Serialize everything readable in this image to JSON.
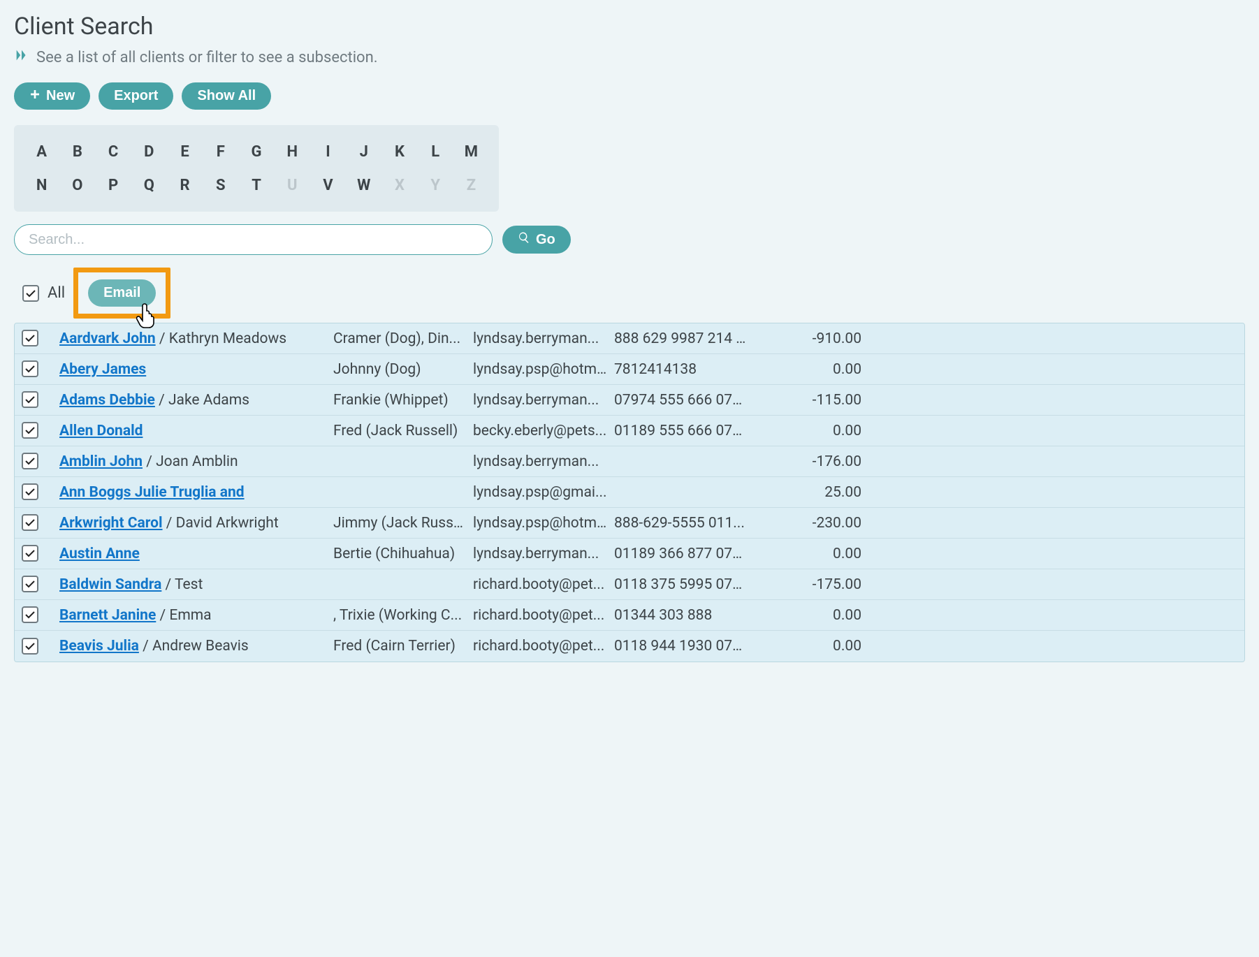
{
  "page": {
    "title": "Client Search",
    "subtitle": "See a list of all clients or filter to see a subsection."
  },
  "actions": {
    "new": "New",
    "export": "Export",
    "show_all": "Show All"
  },
  "alpha": {
    "row1": [
      {
        "l": "A",
        "on": true
      },
      {
        "l": "B",
        "on": true
      },
      {
        "l": "C",
        "on": true
      },
      {
        "l": "D",
        "on": true
      },
      {
        "l": "E",
        "on": true
      },
      {
        "l": "F",
        "on": true
      },
      {
        "l": "G",
        "on": true
      },
      {
        "l": "H",
        "on": true
      },
      {
        "l": "I",
        "on": true
      },
      {
        "l": "J",
        "on": true
      },
      {
        "l": "K",
        "on": true
      },
      {
        "l": "L",
        "on": true
      },
      {
        "l": "M",
        "on": true
      }
    ],
    "row2": [
      {
        "l": "N",
        "on": true
      },
      {
        "l": "O",
        "on": true
      },
      {
        "l": "P",
        "on": true
      },
      {
        "l": "Q",
        "on": true
      },
      {
        "l": "R",
        "on": true
      },
      {
        "l": "S",
        "on": true
      },
      {
        "l": "T",
        "on": true
      },
      {
        "l": "U",
        "on": false
      },
      {
        "l": "V",
        "on": true
      },
      {
        "l": "W",
        "on": true
      },
      {
        "l": "X",
        "on": false
      },
      {
        "l": "Y",
        "on": false
      },
      {
        "l": "Z",
        "on": false
      }
    ]
  },
  "search": {
    "placeholder": "Search...",
    "value": "",
    "go": "Go"
  },
  "bulk": {
    "all_checked": true,
    "all_label": "All",
    "email": "Email"
  },
  "rows": [
    {
      "checked": true,
      "primary": "Aardvark John",
      "secondary": " / Kathryn Meadows",
      "pet": "Cramer (Dog), Din...",
      "email": "lyndsay.berryman...",
      "phone": "888 629 9987 214 ...",
      "balance": "-910.00"
    },
    {
      "checked": true,
      "primary": "Abery James",
      "secondary": "",
      "pet": "Johnny (Dog)",
      "email": "lyndsay.psp@hotm...",
      "phone": "7812414138",
      "balance": "0.00"
    },
    {
      "checked": true,
      "primary": "Adams Debbie",
      "secondary": " / Jake Adams",
      "pet": "Frankie (Whippet)",
      "email": "lyndsay.berryman...",
      "phone": "07974 555 666 071...",
      "balance": "-115.00"
    },
    {
      "checked": true,
      "primary": "Allen Donald",
      "secondary": "",
      "pet": "Fred (Jack Russell)",
      "email": "becky.eberly@pets...",
      "phone": "01189 555 666 077...",
      "balance": "0.00"
    },
    {
      "checked": true,
      "primary": "Amblin John",
      "secondary": " / Joan Amblin",
      "pet": "",
      "email": "lyndsay.berryman...",
      "phone": "",
      "balance": "-176.00"
    },
    {
      "checked": true,
      "primary": "Ann Boggs Julie Truglia and",
      "secondary": "",
      "pet": "",
      "email": "lyndsay.psp@gmai...",
      "phone": "",
      "balance": "25.00"
    },
    {
      "checked": true,
      "primary": "Arkwright Carol",
      "secondary": " / David Arkwright",
      "pet": "Jimmy (Jack Russell...",
      "email": "lyndsay.psp@hotm...",
      "phone": "888-629-5555 011...",
      "balance": "-230.00"
    },
    {
      "checked": true,
      "primary": "Austin Anne",
      "secondary": "",
      "pet": "Bertie (Chihuahua)",
      "email": "lyndsay.berryman...",
      "phone": "01189 366 877 075...",
      "balance": "0.00"
    },
    {
      "checked": true,
      "primary": "Baldwin Sandra",
      "secondary": " / Test",
      "pet": "",
      "email": "richard.booty@pet...",
      "phone": "0118 375 5995 078...",
      "balance": "-175.00"
    },
    {
      "checked": true,
      "primary": "Barnett Janine",
      "secondary": " / Emma",
      "pet": ", Trixie (Working C...",
      "email": "richard.booty@pet...",
      "phone": "01344 303 888",
      "balance": "0.00"
    },
    {
      "checked": true,
      "primary": "Beavis Julia",
      "secondary": " / Andrew Beavis",
      "pet": "Fred (Cairn Terrier)",
      "email": "richard.booty@pet...",
      "phone": "0118 944 1930 077...",
      "balance": "0.00"
    }
  ]
}
